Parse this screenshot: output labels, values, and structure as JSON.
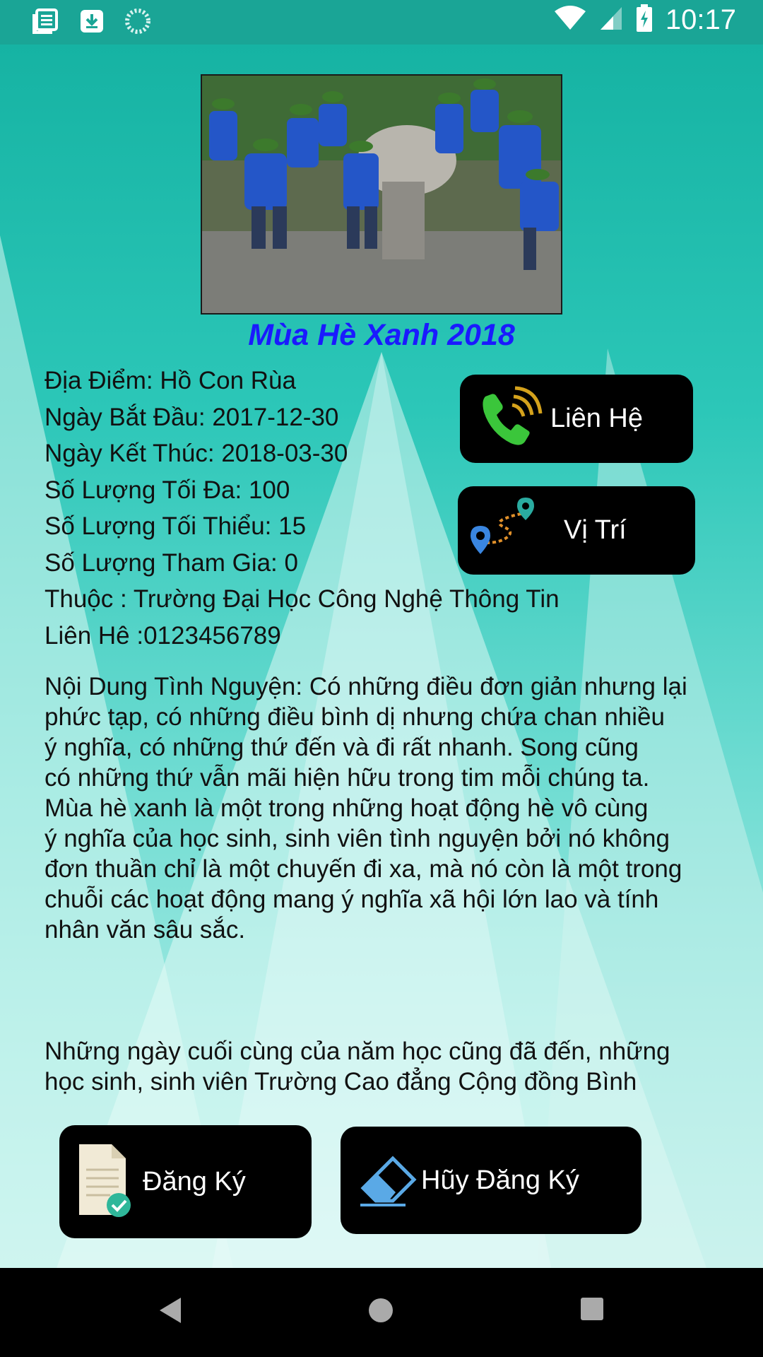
{
  "status_bar": {
    "time": "10:17",
    "icons_left": [
      "news-icon",
      "download-icon",
      "sync-icon"
    ],
    "icons_right": [
      "wifi-icon",
      "signal-icon",
      "battery-icon"
    ]
  },
  "event": {
    "title": "Mùa Hè Xanh 2018",
    "location": "Địa Điểm: Hồ Con Rùa",
    "start_date": "Ngày Bắt Đầu: 2017-12-30",
    "end_date": "Ngày Kết Thúc: 2018-03-30",
    "max_count": "Số Lượng Tối Đa: 100",
    "min_count": "Số Lượng Tối Thiểu: 15",
    "participants": "Số Lượng Tham Gia: 0",
    "belongs_to": "Thuộc : Trường Đại Học Công Nghệ Thông Tin",
    "contact": "Liên Hê :0123456789",
    "description": "Nội Dung Tình Nguyện: Có những điều đơn giản nhưng lại\nphức tạp, có những điều bình dị nhưng chứa chan nhiều\ný nghĩa, có những thứ đến và đi rất nhanh. Song cũng\ncó những thứ vẫn mãi hiện hữu trong tim mỗi chúng ta.\nMùa hè xanh là một trong những hoạt động hè vô cùng\ný nghĩa của học sinh, sinh viên tình nguyện bởi nó không\nđơn thuần chỉ là một chuyến đi xa, mà nó còn là một trong\nchuỗi các hoạt động mang ý nghĩa xã hội lớn lao và tính\nnhân văn sâu sắc.",
    "description_more": "Những ngày cuối cùng của năm học cũng đã đến, những\nhọc sinh, sinh viên Trường Cao đẳng Cộng đồng Bình"
  },
  "buttons": {
    "contact": "Liên Hệ",
    "location": "Vị Trí",
    "register": "Đăng Ký",
    "unregister": "Hũy Đăng Ký"
  },
  "colors": {
    "title": "#1a1aff",
    "status_bar": "#1aa596",
    "button_bg": "#000000"
  }
}
